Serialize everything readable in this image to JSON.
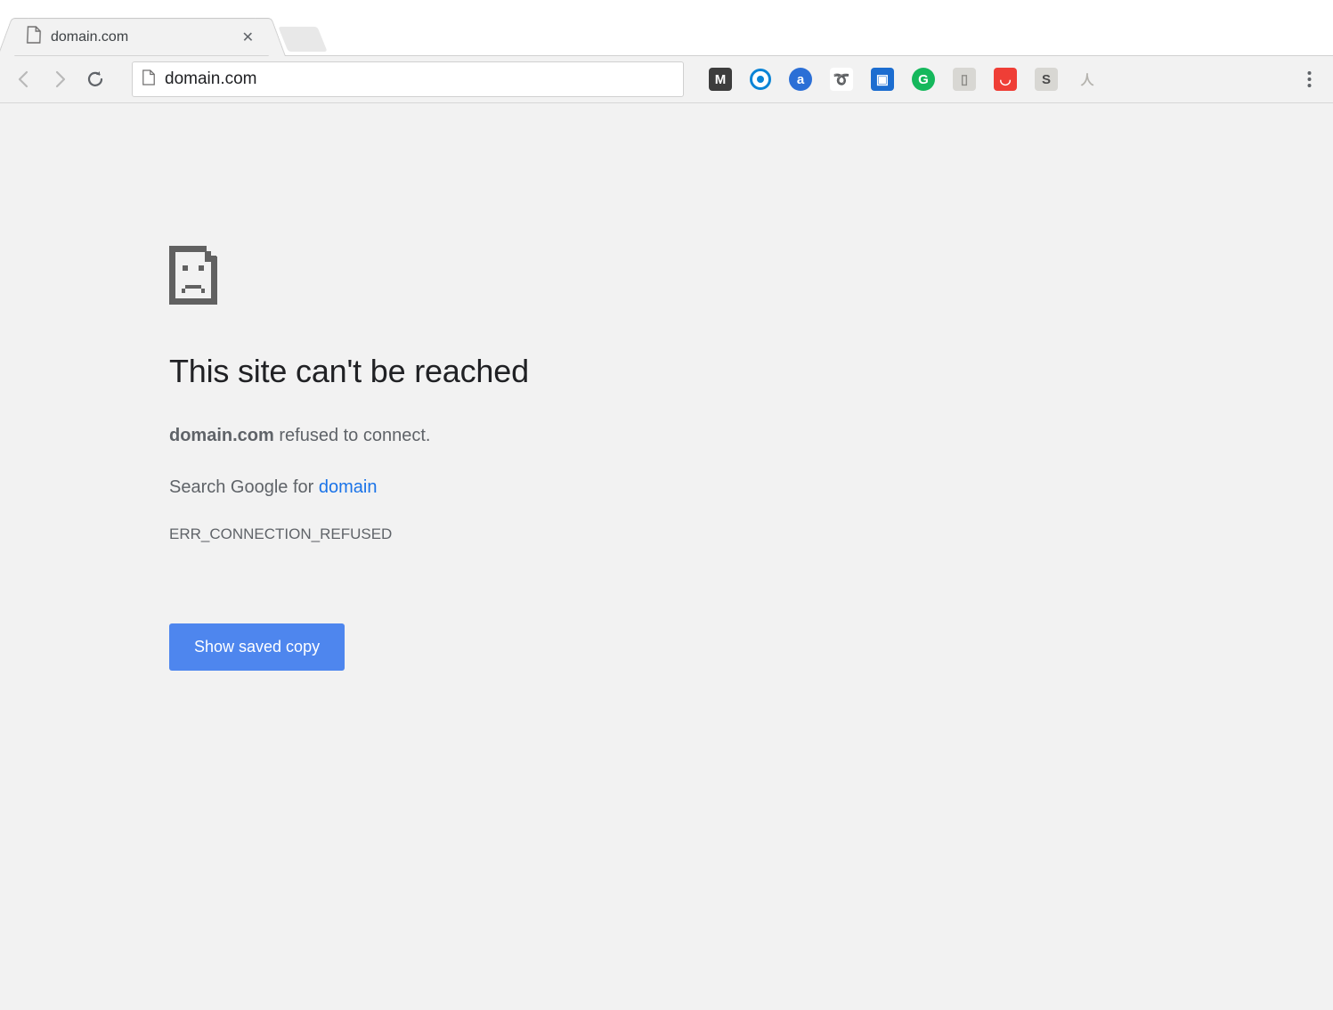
{
  "tab": {
    "title": "domain.com"
  },
  "toolbar": {
    "url": "domain.com"
  },
  "extensions": [
    {
      "name": "mega-ext",
      "bg": "#3d3d3d",
      "fg": "#ffffff",
      "glyph": "M"
    },
    {
      "name": "search-ext",
      "bg": "#ffffff",
      "fg": "#0a84d6",
      "glyph": "◎",
      "ring": true
    },
    {
      "name": "amazon-ext",
      "bg": "#2b6fd6",
      "fg": "#ffffff",
      "glyph": "a",
      "round": true
    },
    {
      "name": "bitly-ext",
      "bg": "#ffffff",
      "fg": "#e86412",
      "glyph": "➰"
    },
    {
      "name": "screenshot-ext",
      "bg": "#1c6dd0",
      "fg": "#ffffff",
      "glyph": "▣"
    },
    {
      "name": "grammarly-ext",
      "bg": "#15b85c",
      "fg": "#ffffff",
      "glyph": "G",
      "round": true
    },
    {
      "name": "doc-ext",
      "bg": "#d8d7d3",
      "fg": "#8d8c88",
      "glyph": "▯"
    },
    {
      "name": "pocket-ext",
      "bg": "#ef3e36",
      "fg": "#ffffff",
      "glyph": "◡"
    },
    {
      "name": "s-ext",
      "bg": "#d8d7d3",
      "fg": "#4a4a4a",
      "glyph": "S"
    },
    {
      "name": "wishbone-ext",
      "bg": "transparent",
      "fg": "#b5b3ae",
      "glyph": "人"
    }
  ],
  "error": {
    "title": "This site can't be reached",
    "host": "domain.com",
    "refused_suffix": " refused to connect.",
    "search_prefix": "Search Google for ",
    "search_term": "domain",
    "code": "ERR_CONNECTION_REFUSED",
    "button": "Show saved copy"
  }
}
